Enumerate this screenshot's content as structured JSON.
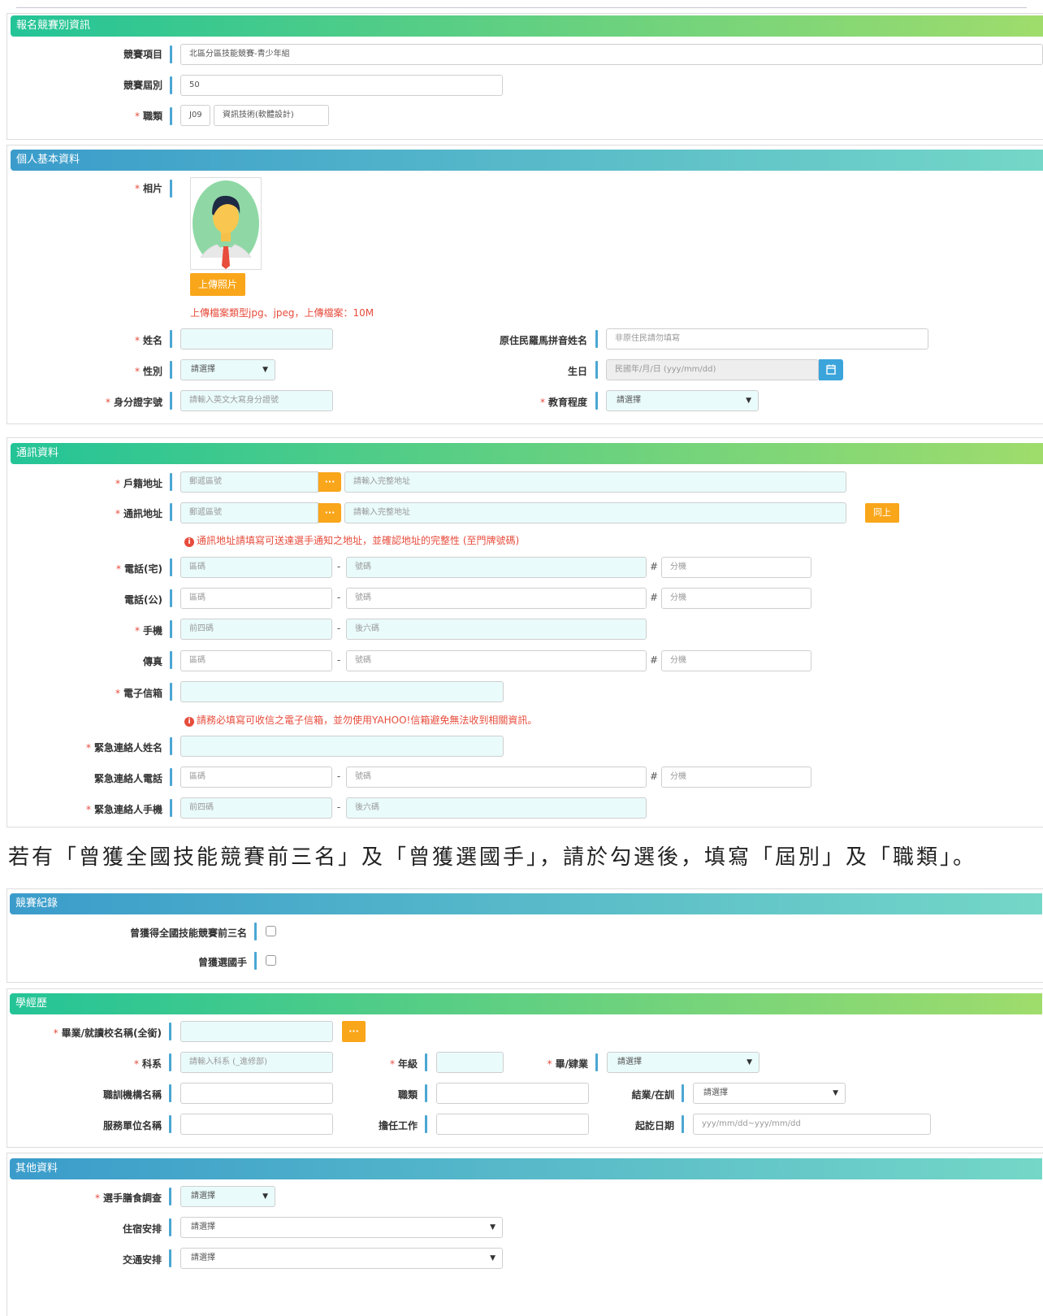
{
  "sections": {
    "competition": "報名競賽別資訊",
    "personal": "個人基本資料",
    "contact": "通訊資料",
    "record": "競賽紀錄",
    "education": "學經歷",
    "other": "其他資料"
  },
  "competition": {
    "item_label": "競賽項目",
    "item_value": "北區分區技能競賽-青少年組",
    "session_label": "競賽屆別",
    "session_value": "50",
    "trade_label": "職類",
    "trade_code": "J09",
    "trade_name": "資訊技術(軟體設計)"
  },
  "personal": {
    "photo_label": "相片",
    "upload_button": "上傳照片",
    "upload_note": "上傳檔案類型jpg、jpeg，上傳檔案：10M",
    "name_label": "姓名",
    "roman_name_label": "原住民羅馬拼音姓名",
    "roman_name_placeholder": "非原住民請勿填寫",
    "gender_label": "性別",
    "gender_value": "請選擇",
    "birth_label": "生日",
    "birth_placeholder": "民國年/月/日 (yyy/mm/dd)",
    "id_label": "身分證字號",
    "id_placeholder": "請輸入英文大寫身分證號",
    "edu_label": "教育程度",
    "edu_value": "請選擇"
  },
  "contact": {
    "household_label": "戶籍地址",
    "mailing_label": "通訊地址",
    "zip_placeholder": "郵遞區號",
    "addr_placeholder": "請輸入完整地址",
    "dots": "···",
    "same_button": "同上",
    "addr_note": "通訊地址請填寫可送達選手通知之地址，並確認地址的完整性 (至門牌號碼)",
    "home_phone_label": "電話(宅)",
    "office_phone_label": "電話(公)",
    "mobile_label": "手機",
    "fax_label": "傳真",
    "email_label": "電子信箱",
    "email_note": "請務必填寫可收信之電子信箱，並勿使用YAHOO!信箱避免無法收到相關資訊。",
    "emg_name_label": "緊急連絡人姓名",
    "emg_phone_label": "緊急連絡人電話",
    "emg_mobile_label": "緊急連絡人手機",
    "area_placeholder": "區碼",
    "number_placeholder": "號碼",
    "ext_placeholder": "分機",
    "first4_placeholder": "前四碼",
    "last6_placeholder": "後六碼",
    "dash": "-",
    "hash": "#",
    "info_icon": "i"
  },
  "instruction": "若有「曾獲全國技能競賽前三名」及「曾獲選國手」，請於勾選後，填寫「屆別」及「職類」。",
  "record": {
    "top3_label": "曾獲得全國技能競賽前三名",
    "national_label": "曾獲選國手"
  },
  "education": {
    "school_label": "畢業/就讀校名稱(全銜)",
    "dept_label": "科系",
    "dept_placeholder": "請輸入科系 (_進修部)",
    "grade_label": "年級",
    "grad_label": "畢/肄業",
    "grad_value": "請選擇",
    "training_label": "職訓機構名稱",
    "trade_label": "職類",
    "status_label": "結業/在訓",
    "status_value": "請選擇",
    "employer_label": "服務單位名稱",
    "job_label": "擔任工作",
    "period_label": "起訖日期",
    "period_placeholder": "yyy/mm/dd~yyy/mm/dd"
  },
  "other": {
    "diet_label": "選手膳食調查",
    "diet_value": "請選擇",
    "lodging_label": "住宿安排",
    "lodging_value": "請選擇",
    "transport_label": "交通安排",
    "transport_value": "請選擇"
  },
  "required_mark": "*",
  "dropdown_arrow": "▼",
  "calendar_icon": "calendar-icon"
}
